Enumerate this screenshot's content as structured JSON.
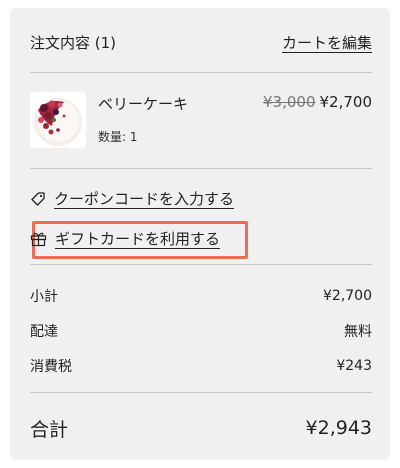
{
  "order": {
    "title": "注文内容 (1)",
    "edit_cart_label": "カートを編集"
  },
  "item": {
    "name": "ベリーケーキ",
    "quantity_label": "数量: 1",
    "original_price": "¥3,000",
    "sale_price": "¥2,700",
    "image_icon": "berry-cake-image"
  },
  "links": {
    "coupon_label": "クーポンコードを入力する",
    "coupon_icon": "tag-icon",
    "gift_label": "ギフトカードを利用する",
    "gift_icon": "gift-icon",
    "highlight_color": "#ee6b55"
  },
  "summary": {
    "subtotal_label": "小計",
    "subtotal_value": "¥2,700",
    "shipping_label": "配達",
    "shipping_value": "無料",
    "tax_label": "消費税",
    "tax_value": "¥243",
    "total_label": "合計",
    "total_value": "¥2,943"
  },
  "colors": {
    "panel_bg": "#f0f0f0",
    "text": "#222222",
    "divider": "#c8c8c8"
  }
}
